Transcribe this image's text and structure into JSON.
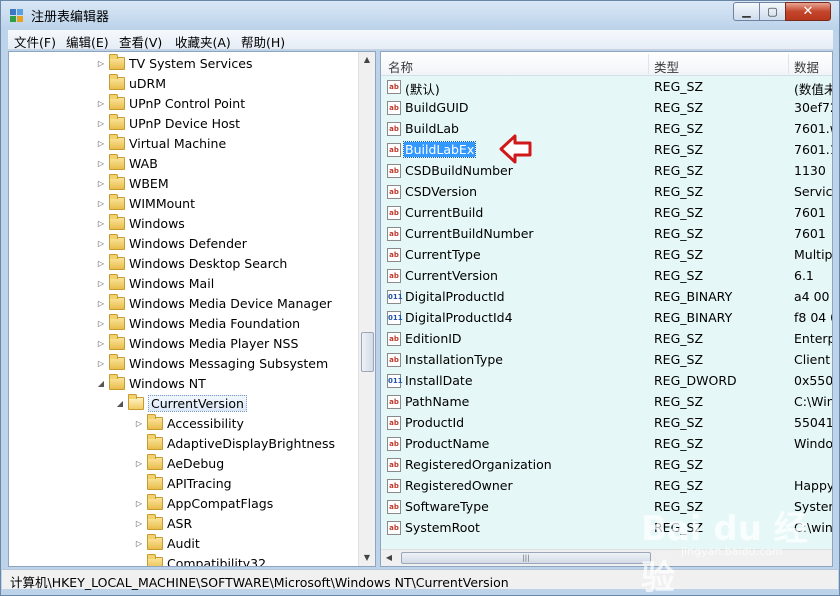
{
  "window": {
    "title": "注册表编辑器"
  },
  "menu": [
    "文件(F)",
    "编辑(E)",
    "查看(V)",
    "收藏夹(A)",
    "帮助(H)"
  ],
  "tree": [
    {
      "label": "TV System Services",
      "indent": 0,
      "expander": "▷"
    },
    {
      "label": "uDRM",
      "indent": 0,
      "expander": ""
    },
    {
      "label": "UPnP Control Point",
      "indent": 0,
      "expander": "▷"
    },
    {
      "label": "UPnP Device Host",
      "indent": 0,
      "expander": "▷"
    },
    {
      "label": "Virtual Machine",
      "indent": 0,
      "expander": "▷"
    },
    {
      "label": "WAB",
      "indent": 0,
      "expander": "▷"
    },
    {
      "label": "WBEM",
      "indent": 0,
      "expander": "▷"
    },
    {
      "label": "WIMMount",
      "indent": 0,
      "expander": "▷"
    },
    {
      "label": "Windows",
      "indent": 0,
      "expander": "▷"
    },
    {
      "label": "Windows Defender",
      "indent": 0,
      "expander": "▷"
    },
    {
      "label": "Windows Desktop Search",
      "indent": 0,
      "expander": "▷"
    },
    {
      "label": "Windows Mail",
      "indent": 0,
      "expander": "▷"
    },
    {
      "label": "Windows Media Device Manager",
      "indent": 0,
      "expander": "▷"
    },
    {
      "label": "Windows Media Foundation",
      "indent": 0,
      "expander": "▷"
    },
    {
      "label": "Windows Media Player NSS",
      "indent": 0,
      "expander": "▷"
    },
    {
      "label": "Windows Messaging Subsystem",
      "indent": 0,
      "expander": "▷"
    },
    {
      "label": "Windows NT",
      "indent": 0,
      "expander": "◢"
    },
    {
      "label": "CurrentVersion",
      "indent": 1,
      "expander": "◢",
      "selected": true
    },
    {
      "label": "Accessibility",
      "indent": 2,
      "expander": "▷"
    },
    {
      "label": "AdaptiveDisplayBrightness",
      "indent": 2,
      "expander": ""
    },
    {
      "label": "AeDebug",
      "indent": 2,
      "expander": "▷"
    },
    {
      "label": "APITracing",
      "indent": 2,
      "expander": ""
    },
    {
      "label": "AppCompatFlags",
      "indent": 2,
      "expander": "▷"
    },
    {
      "label": "ASR",
      "indent": 2,
      "expander": "▷"
    },
    {
      "label": "Audit",
      "indent": 2,
      "expander": "▷"
    },
    {
      "label": "Compatibility32",
      "indent": 2,
      "expander": ""
    }
  ],
  "columns": {
    "name": "名称",
    "type": "类型",
    "data": "数据"
  },
  "values": [
    {
      "name": "(默认)",
      "type": "REG_SZ",
      "data": "(数值未",
      "icon": "ab"
    },
    {
      "name": "BuildGUID",
      "type": "REG_SZ",
      "data": "30ef72",
      "icon": "ab"
    },
    {
      "name": "BuildLab",
      "type": "REG_SZ",
      "data": "7601.w",
      "icon": "ab"
    },
    {
      "name": "BuildLabEx",
      "type": "REG_SZ",
      "data": "7601.1",
      "icon": "ab",
      "selected": true
    },
    {
      "name": "CSDBuildNumber",
      "type": "REG_SZ",
      "data": "1130",
      "icon": "ab"
    },
    {
      "name": "CSDVersion",
      "type": "REG_SZ",
      "data": "Service",
      "icon": "ab"
    },
    {
      "name": "CurrentBuild",
      "type": "REG_SZ",
      "data": "7601",
      "icon": "ab"
    },
    {
      "name": "CurrentBuildNumber",
      "type": "REG_SZ",
      "data": "7601",
      "icon": "ab"
    },
    {
      "name": "CurrentType",
      "type": "REG_SZ",
      "data": "Multip",
      "icon": "ab"
    },
    {
      "name": "CurrentVersion",
      "type": "REG_SZ",
      "data": "6.1",
      "icon": "ab"
    },
    {
      "name": "DigitalProductId",
      "type": "REG_BINARY",
      "data": "a4 00 (",
      "icon": "bin"
    },
    {
      "name": "DigitalProductId4",
      "type": "REG_BINARY",
      "data": "f8 04 0",
      "icon": "bin"
    },
    {
      "name": "EditionID",
      "type": "REG_SZ",
      "data": "Enterp",
      "icon": "ab"
    },
    {
      "name": "InstallationType",
      "type": "REG_SZ",
      "data": "Client",
      "icon": "ab"
    },
    {
      "name": "InstallDate",
      "type": "REG_DWORD",
      "data": "0x550c",
      "icon": "bin"
    },
    {
      "name": "PathName",
      "type": "REG_SZ",
      "data": "C:\\Win",
      "icon": "ab"
    },
    {
      "name": "ProductId",
      "type": "REG_SZ",
      "data": "55041-",
      "icon": "ab"
    },
    {
      "name": "ProductName",
      "type": "REG_SZ",
      "data": "Windo",
      "icon": "ab"
    },
    {
      "name": "RegisteredOrganization",
      "type": "REG_SZ",
      "data": "",
      "icon": "ab"
    },
    {
      "name": "RegisteredOwner",
      "type": "REG_SZ",
      "data": "Happy",
      "icon": "ab"
    },
    {
      "name": "SoftwareType",
      "type": "REG_SZ",
      "data": "System",
      "icon": "ab"
    },
    {
      "name": "SystemRoot",
      "type": "REG_SZ",
      "data": "C:\\win",
      "icon": "ab"
    }
  ],
  "status": "计算机\\HKEY_LOCAL_MACHINE\\SOFTWARE\\Microsoft\\Windows NT\\CurrentVersion",
  "watermark": {
    "main": "Bai du 经验",
    "sub": "jingyan.baidu.com"
  }
}
